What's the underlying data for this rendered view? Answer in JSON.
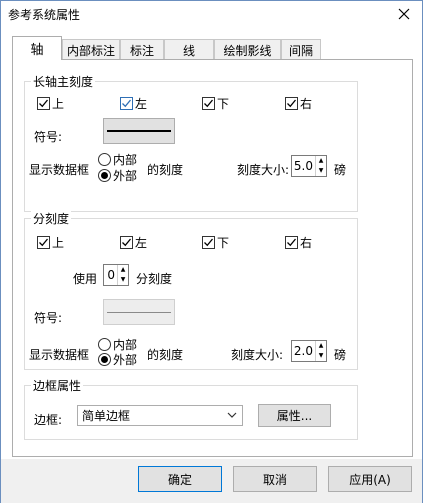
{
  "window": {
    "title": "参考系统属性"
  },
  "tabs": [
    {
      "label": "轴"
    },
    {
      "label": "内部标注"
    },
    {
      "label": "标注"
    },
    {
      "label": "线"
    },
    {
      "label": "绘制影线"
    },
    {
      "label": "间隔"
    }
  ],
  "major": {
    "title": "长轴主刻度",
    "checkboxes": [
      {
        "label": "上",
        "checked": true
      },
      {
        "label": "左",
        "checked": true
      },
      {
        "label": "下",
        "checked": true
      },
      {
        "label": "右",
        "checked": true
      }
    ],
    "symbol_label": "符号:",
    "display_label": "显示数据框",
    "radio_inside": "内部",
    "radio_outside": "外部",
    "selected": "外部",
    "ticks_label": "的刻度",
    "size_label": "刻度大小:",
    "size_value": "5.0",
    "unit": "磅"
  },
  "minor": {
    "title": "分刻度",
    "checkboxes": [
      {
        "label": "上",
        "checked": true
      },
      {
        "label": "左",
        "checked": true
      },
      {
        "label": "下",
        "checked": true
      },
      {
        "label": "右",
        "checked": true
      }
    ],
    "use_label": "使用",
    "use_value": "0",
    "subticks_label": "分刻度",
    "symbol_label": "符号:",
    "display_label": "显示数据框",
    "radio_inside": "内部",
    "radio_outside": "外部",
    "selected": "外部",
    "ticks_label": "的刻度",
    "size_label": "刻度大小:",
    "size_value": "2.0",
    "unit": "磅"
  },
  "frame": {
    "title": "边框属性",
    "frame_label": "边框:",
    "frame_value": "简单边框",
    "properties_button": "属性..."
  },
  "footer": {
    "ok": "确定",
    "cancel": "取消",
    "apply": "应用(A)"
  },
  "colors": {
    "accent": "#0078d7",
    "check_blue": "#2f6fb5"
  }
}
